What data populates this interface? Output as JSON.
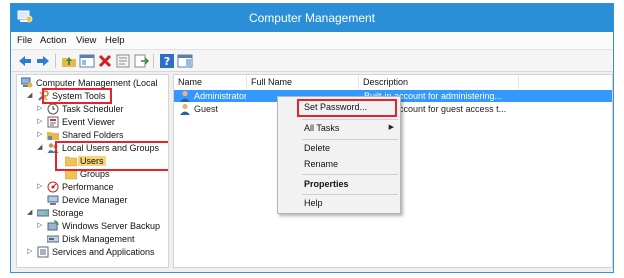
{
  "window": {
    "title": "Computer Management"
  },
  "menubar": {
    "file": "File",
    "action": "Action",
    "view": "View",
    "help": "Help"
  },
  "tree": {
    "root": "Computer Management (Local",
    "system_tools": "System Tools",
    "task_scheduler": "Task Scheduler",
    "event_viewer": "Event Viewer",
    "shared_folders": "Shared Folders",
    "local_users_groups": "Local Users and Groups",
    "users": "Users",
    "groups": "Groups",
    "performance": "Performance",
    "device_manager": "Device Manager",
    "storage": "Storage",
    "wsb": "Windows Server Backup",
    "disk_management": "Disk Management",
    "services_apps": "Services and Applications"
  },
  "list": {
    "columns": {
      "name": "Name",
      "full_name": "Full Name",
      "description": "Description"
    },
    "rows": [
      {
        "name": "Administrator",
        "full_name": "",
        "description": "Built-in account for administering..."
      },
      {
        "name": "Guest",
        "full_name": "",
        "description": "Built-in account for guest access t..."
      }
    ]
  },
  "context_menu": {
    "set_password": "Set Password...",
    "all_tasks": "All Tasks",
    "delete": "Delete",
    "rename": "Rename",
    "properties": "Properties",
    "help": "Help"
  },
  "colors": {
    "titlebar": "#2b8fd8",
    "selection": "#3399ff",
    "tree_selection": "#f5d576",
    "highlight_box": "#e8222a"
  },
  "icons": {
    "toolbar": [
      "back-arrow-icon",
      "forward-arrow-icon",
      "up-folder-icon",
      "show-hide-tree-icon",
      "delete-icon",
      "properties-icon",
      "export-icon",
      "help-icon",
      "action-pane-icon"
    ]
  }
}
